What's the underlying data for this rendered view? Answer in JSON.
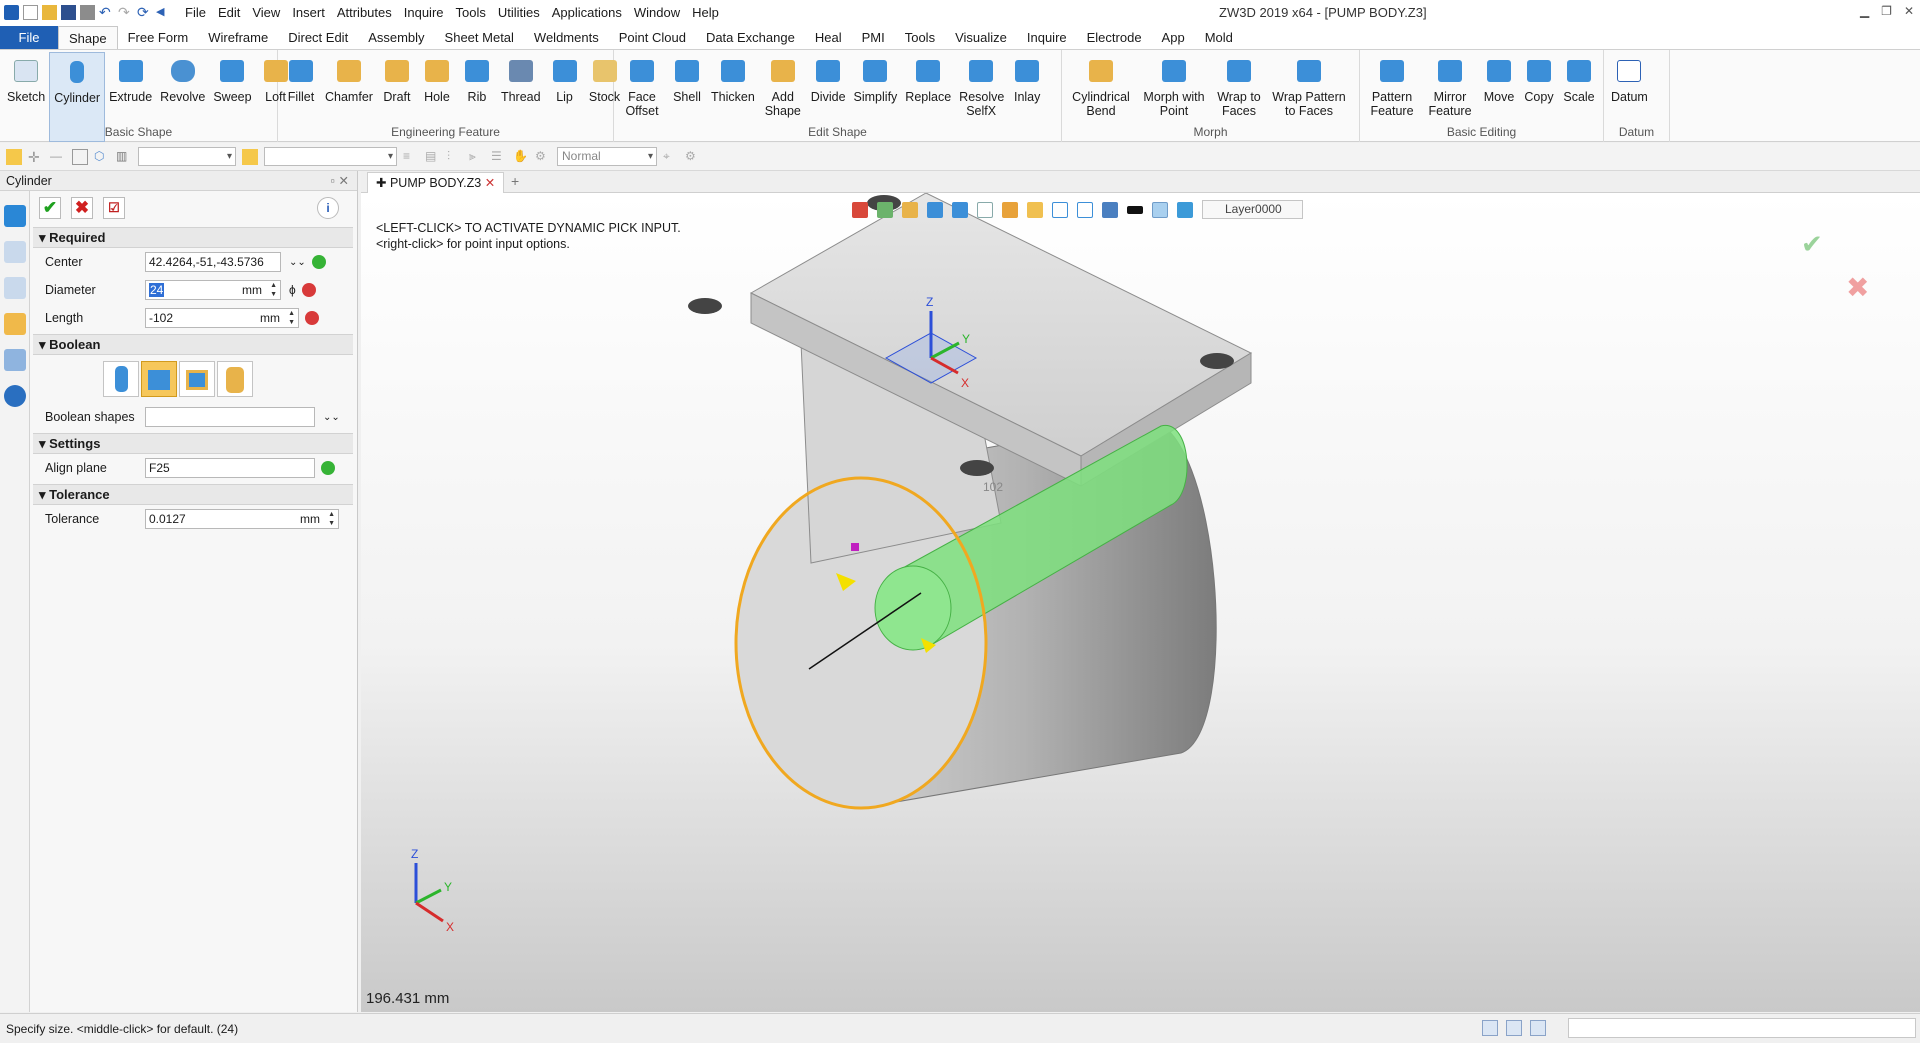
{
  "window": {
    "title": "ZW3D 2019  x64 - [PUMP BODY.Z3]",
    "menu": [
      "File",
      "Edit",
      "View",
      "Insert",
      "Attributes",
      "Inquire",
      "Tools",
      "Utilities",
      "Applications",
      "Window",
      "Help"
    ]
  },
  "ribbon_tabs": [
    "File",
    "Shape",
    "Free Form",
    "Wireframe",
    "Direct Edit",
    "Assembly",
    "Sheet Metal",
    "Weldments",
    "Point Cloud",
    "Data Exchange",
    "Heal",
    "PMI",
    "Tools",
    "Visualize",
    "Inquire",
    "Electrode",
    "App",
    "Mold"
  ],
  "ribbon_groups": [
    {
      "label": "Basic Shape",
      "buttons": [
        "Sketch",
        "Cylinder",
        "Extrude",
        "Revolve",
        "Sweep",
        "Loft"
      ]
    },
    {
      "label": "Engineering Feature",
      "buttons": [
        "Fillet",
        "Chamfer",
        "Draft",
        "Hole",
        "Rib",
        "Thread",
        "Lip",
        "Stock"
      ]
    },
    {
      "label": "Edit Shape",
      "buttons": [
        "Face Offset",
        "Shell",
        "Thicken",
        "Add Shape",
        "Divide",
        "Simplify",
        "Replace",
        "Resolve SelfX",
        "Inlay"
      ]
    },
    {
      "label": "Morph",
      "buttons": [
        "Cylindrical Bend",
        "Morph with Point",
        "Wrap to Faces",
        "Wrap Pattern to Faces"
      ]
    },
    {
      "label": "Basic Editing",
      "buttons": [
        "Pattern Feature",
        "Mirror Feature",
        "Move",
        "Copy",
        "Scale"
      ]
    },
    {
      "label": "Datum",
      "buttons": [
        "Datum"
      ]
    }
  ],
  "toolbar2": {
    "filter_value": "",
    "render_mode": "Normal"
  },
  "panel": {
    "title": "Cylinder",
    "sections": {
      "required": "Required",
      "boolean": "Boolean",
      "settings": "Settings",
      "tolerance": "Tolerance"
    },
    "center": {
      "label": "Center",
      "value": "42.4264,-51,-43.5736"
    },
    "diameter": {
      "label": "Diameter",
      "value": "24",
      "unit": "mm"
    },
    "length": {
      "label": "Length",
      "value": "-102",
      "unit": "mm"
    },
    "boolean_shapes": {
      "label": "Boolean shapes",
      "value": ""
    },
    "align_plane": {
      "label": "Align plane",
      "value": "F25"
    },
    "tolerance": {
      "label": "Tolerance",
      "value": "0.0127",
      "unit": "mm"
    }
  },
  "document_tab": "PUMP BODY.Z3",
  "viewport": {
    "message_1": "<LEFT-CLICK> TO ACTIVATE DYNAMIC PICK INPUT.",
    "message_2": "<right-click> for point input options.",
    "layer": "Layer0000",
    "distance": "196.431 mm",
    "dim_label": "102",
    "axis": {
      "x": "X",
      "y": "Y",
      "z": "Z"
    }
  },
  "status": "Specify size.  <middle-click> for default. (24)",
  "colors": {
    "accent": "#1f5fb4",
    "highlight_green": "#7ee07e",
    "orange_edge": "#f0a820"
  }
}
